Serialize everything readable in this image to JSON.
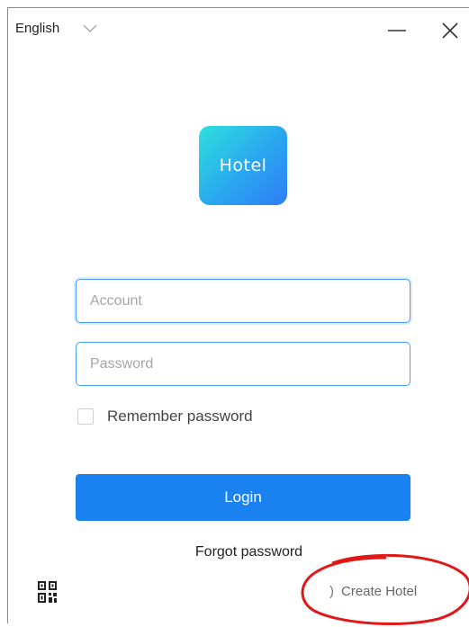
{
  "language": {
    "selected": "English"
  },
  "window_controls": {
    "minimize_icon": "minus-icon",
    "close_icon": "close-icon"
  },
  "logo": {
    "text": "Hotel"
  },
  "form": {
    "account_placeholder": "Account",
    "password_placeholder": "Password",
    "remember_label": "Remember password",
    "login_label": "Login",
    "forgot_label": "Forgot password"
  },
  "footer": {
    "qr_icon": "qr-code-icon",
    "create_hotel_prefix": ")",
    "create_hotel_label": "Create Hotel"
  },
  "colors": {
    "primary": "#1a82f0",
    "input_border": "#4a9df5",
    "logo_gradient_start": "#2ee0dd",
    "logo_gradient_end": "#2f7cf5",
    "annotation": "#e01818"
  }
}
